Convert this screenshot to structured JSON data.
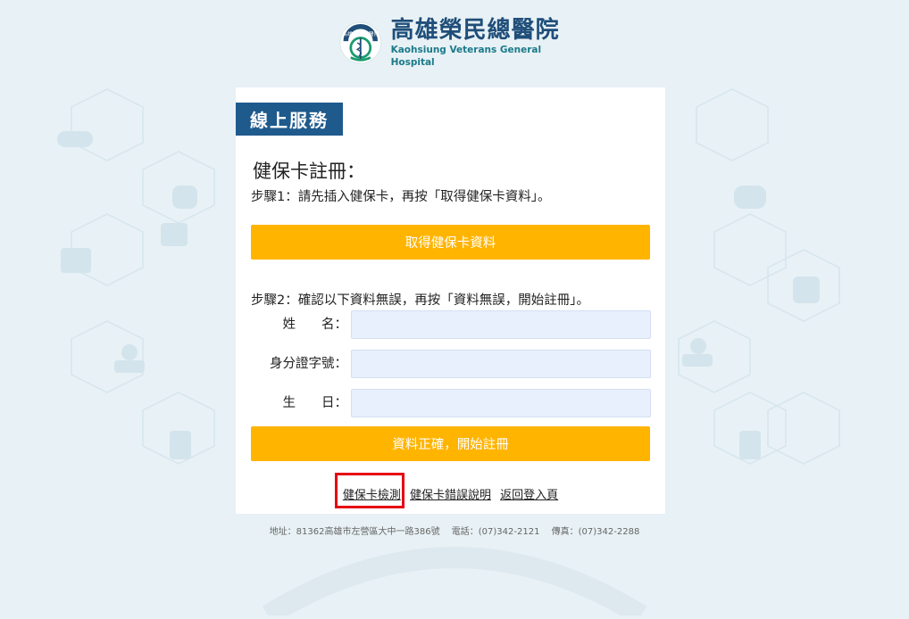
{
  "hospital": {
    "name_zh": "高雄榮民總醫院",
    "name_en": "Kaohsiung Veterans General Hospital",
    "emblem_text": "高雄榮民總醫院",
    "emblem_icon": "caduceus-icon"
  },
  "panel": {
    "tab_label": "線上服務",
    "title": "健保卡註冊：",
    "step1": "步驟1：請先插入健保卡，再按「取得健保卡資料」。",
    "get_card_button": "取得健保卡資料",
    "step2": "步驟2：確認以下資料無誤，再按「資料無誤，開始註冊」。",
    "fields": {
      "name_label": "姓　　名：",
      "id_label": "身分證字號：",
      "dob_label": "生　　日：",
      "name_value": "",
      "id_value": "",
      "dob_value": ""
    },
    "confirm_button": "資料正確，開始註冊",
    "links": {
      "card_check": "健保卡檢測",
      "card_error": "健保卡錯誤說明",
      "back_login": "返回登入頁"
    }
  },
  "footer": {
    "address": "地址：81362高雄市左營區大中一路386號",
    "phone": "電話：(07)342-2121",
    "fax": "傳真：(07)342-2288"
  },
  "colors": {
    "tab": "#1f5a8c",
    "button": "#ffb400",
    "input_bg": "#e8f0fe",
    "highlight": "#e60012",
    "background": "#e8f1f5"
  }
}
